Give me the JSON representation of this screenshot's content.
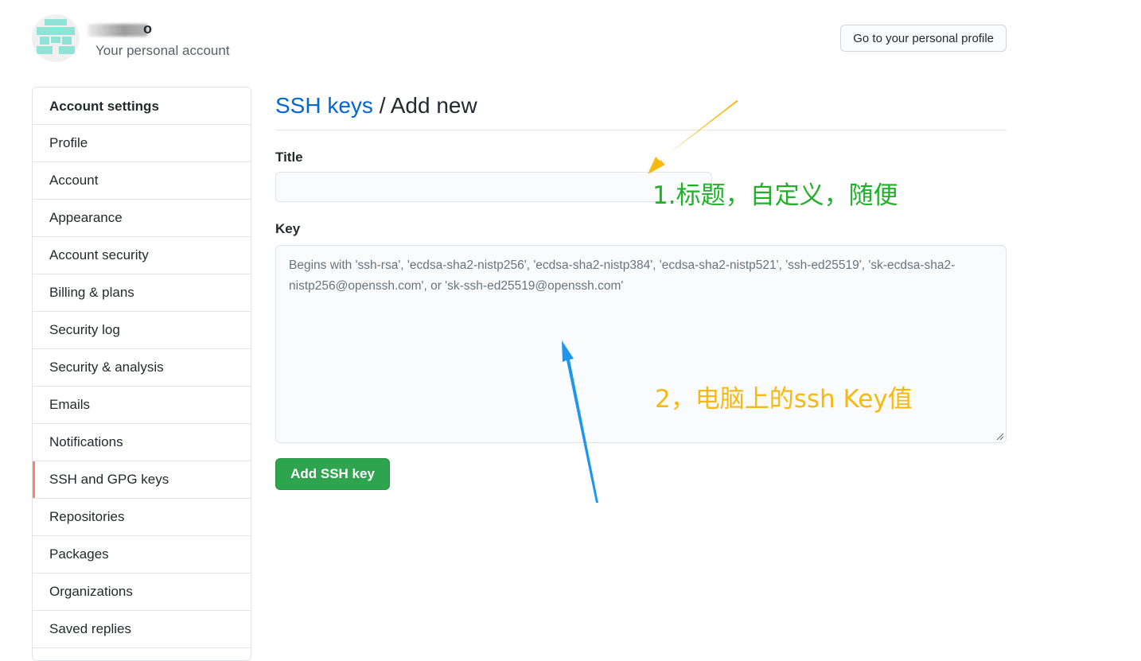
{
  "header": {
    "username_tail": "o",
    "subtitle": "Your personal account",
    "profile_button": "Go to your personal profile"
  },
  "sidebar": {
    "heading": "Account settings",
    "items": [
      {
        "label": "Profile"
      },
      {
        "label": "Account"
      },
      {
        "label": "Appearance"
      },
      {
        "label": "Account security"
      },
      {
        "label": "Billing & plans"
      },
      {
        "label": "Security log"
      },
      {
        "label": "Security & analysis"
      },
      {
        "label": "Emails"
      },
      {
        "label": "Notifications"
      },
      {
        "label": "SSH and GPG keys",
        "active": true
      },
      {
        "label": "Repositories"
      },
      {
        "label": "Packages"
      },
      {
        "label": "Organizations"
      },
      {
        "label": "Saved replies"
      }
    ]
  },
  "main": {
    "breadcrumb_link": "SSH keys",
    "breadcrumb_rest": " / Add new",
    "title_label": "Title",
    "title_value": "",
    "key_label": "Key",
    "key_placeholder": "Begins with 'ssh-rsa', 'ecdsa-sha2-nistp256', 'ecdsa-sha2-nistp384', 'ecdsa-sha2-nistp521', 'ssh-ed25519', 'sk-ecdsa-sha2-nistp256@openssh.com', or 'sk-ssh-ed25519@openssh.com'",
    "submit_button": "Add SSH key"
  },
  "annotations": {
    "note1": "1.标题，自定义，随便",
    "note1_color": "#22b02a",
    "note2": "2，电脑上的ssh Key值",
    "note2_color": "#f7b90f",
    "arrow1_color": "#f7b90f",
    "arrow2_color": "#1e96f0"
  },
  "colors": {
    "link": "#0366d6",
    "primary_button": "#2ea44f",
    "active_marker": "#f9826c"
  }
}
